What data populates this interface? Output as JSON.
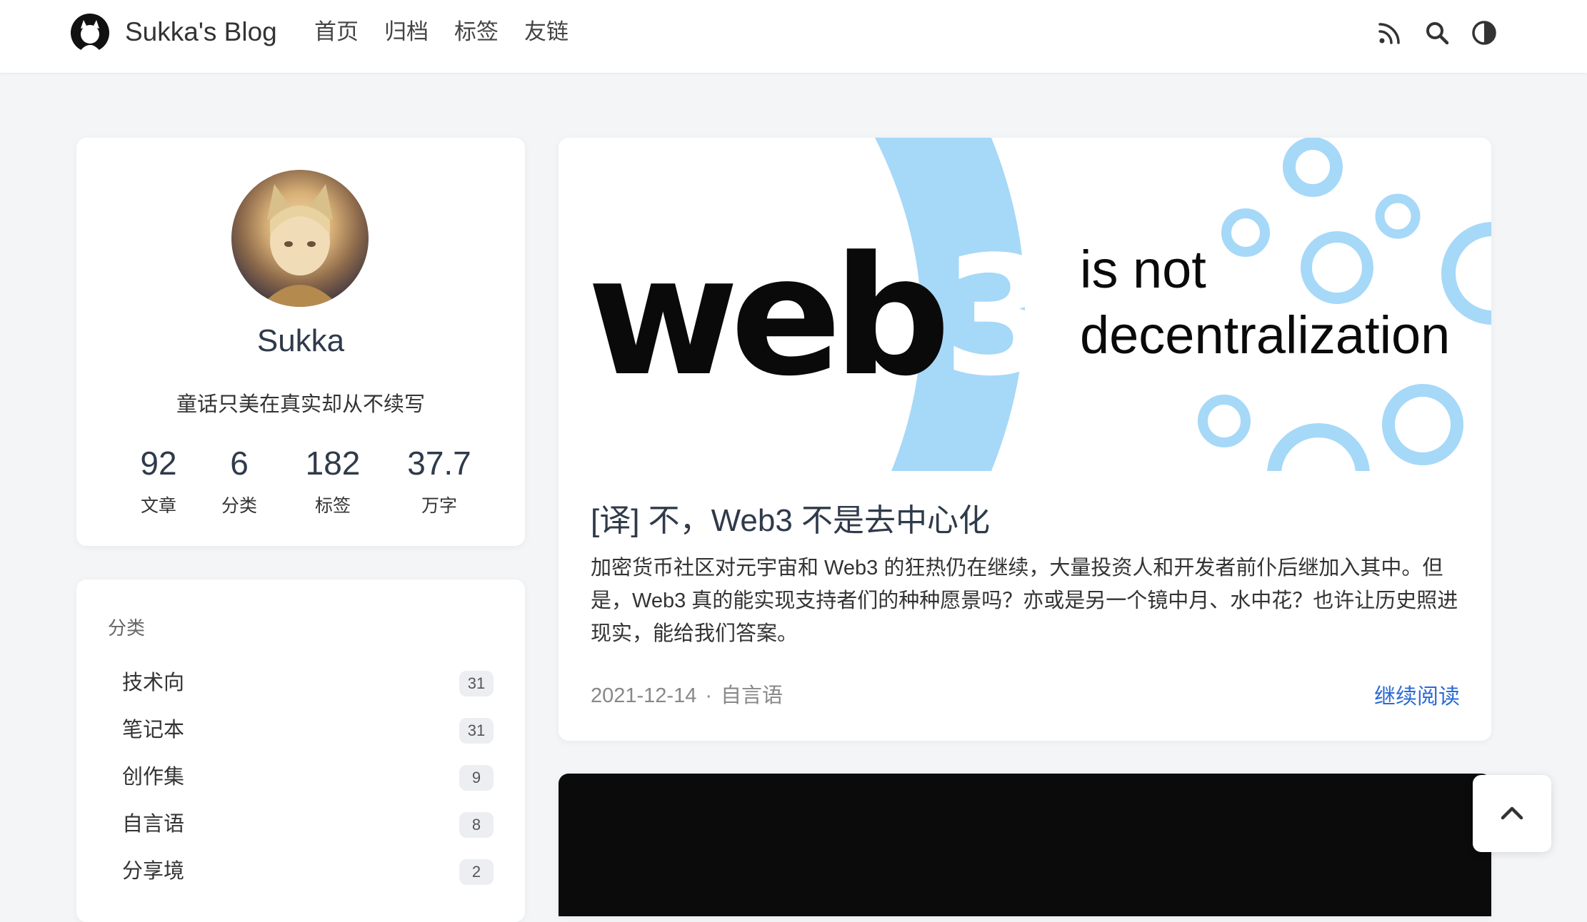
{
  "header": {
    "brand": "Sukka's Blog",
    "nav": [
      "首页",
      "归档",
      "标签",
      "友链"
    ],
    "icons": [
      "rss-icon",
      "search-icon",
      "theme-toggle-icon"
    ]
  },
  "profile": {
    "name": "Sukka",
    "motto": "童话只美在真实却从不续写",
    "stats": [
      {
        "num": "92",
        "label": "文章"
      },
      {
        "num": "6",
        "label": "分类"
      },
      {
        "num": "182",
        "label": "标签"
      },
      {
        "num": "37.7",
        "label": "万字"
      }
    ]
  },
  "categories": {
    "title": "分类",
    "items": [
      {
        "name": "技术向",
        "count": "31"
      },
      {
        "name": "笔记本",
        "count": "31"
      },
      {
        "name": "创作集",
        "count": "9"
      },
      {
        "name": "自言语",
        "count": "8"
      },
      {
        "name": "分享境",
        "count": "2"
      }
    ]
  },
  "post": {
    "banner": {
      "word": "web",
      "digit": "3",
      "line1": "is not",
      "line2": "decentralization",
      "accent": "#a6d8f8"
    },
    "title": "[译] 不，Web3 不是去中心化",
    "excerpt": "加密货币社区对元宇宙和 Web3 的狂热仍在继续，大量投资人和开发者前仆后继加入其中。但是，Web3 真的能实现支持者们的种种愿景吗？亦或是另一个镜中月、水中花？也许让历史照进现实，能给我们答案。",
    "date": "2021-12-14",
    "separator": "·",
    "category": "自言语",
    "read_more": "继续阅读"
  },
  "colors": {
    "link": "#2a6ad6",
    "page_bg": "#f4f5f7",
    "banner_blue": "#a6d8f8"
  }
}
